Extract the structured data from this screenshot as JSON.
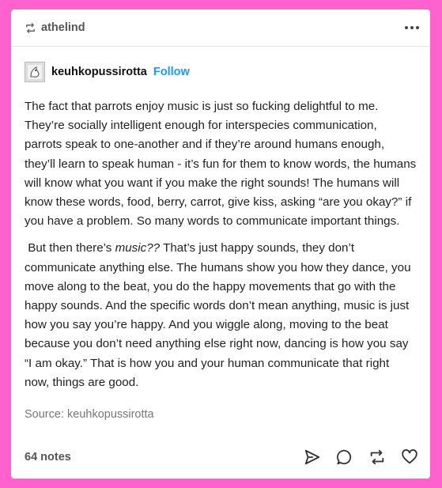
{
  "header": {
    "reblogger": "athelind",
    "icons": {
      "reblog": "reblog-icon",
      "more": "more-icon"
    }
  },
  "post": {
    "author": "keuhkopussirotta",
    "follow_label": "Follow",
    "avatar_icon": "avatar-image",
    "paragraph1": "The fact that parrots enjoy music is just so fucking delightful to me. They’re socially intelligent enough for interspecies communication, parrots speak to one-another and if they’re around humans enough, they’ll learn to speak human - it’s fun for them to know words, the humans will know what you want if you make the right sounds! The humans will know these words, food, berry, carrot, give kiss, asking “are you okay?” if you have a problem. So many words to communicate important things.",
    "paragraph2_start": " But then there’s ",
    "paragraph2_emph": "music??",
    "paragraph2_rest": " That’s just happy sounds, they don’t communicate anything else. The humans show you how they dance, you move along to the beat, you do the happy movements that go with the happy sounds. And the specific words don’t mean anything, music is just how you say you’re happy. And you wiggle along, moving to the beat because you don’t need anything else right now, dancing is how you say “I am okay.” That is how you and your human communicate that right now, things are good.",
    "source": "Source: keuhkopussirotta"
  },
  "footer": {
    "notes": "64 notes",
    "icons": [
      "share-icon",
      "reply-icon",
      "reblog-icon",
      "like-icon"
    ]
  },
  "colors": {
    "background": "#ff62ce",
    "follow": "#1a9cf0",
    "card": "#ffffff"
  }
}
